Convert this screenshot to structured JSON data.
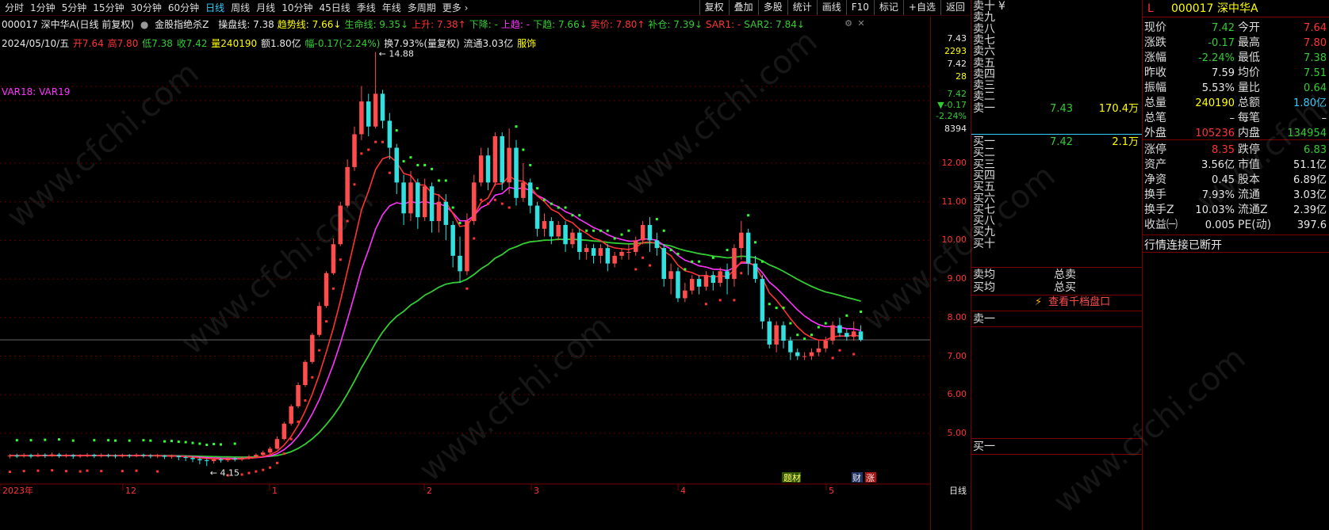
{
  "toolbar": {
    "periods": [
      "分时",
      "1分钟",
      "5分钟",
      "15分钟",
      "30分钟",
      "60分钟",
      "日线",
      "周线",
      "月线",
      "10分钟",
      "45日线",
      "季线",
      "年线",
      "多周期",
      "更多 ›"
    ],
    "active_period": "日线",
    "actions": [
      "复权",
      "叠加",
      "多股",
      "统计",
      "画线",
      "F10",
      "标记",
      "+自选",
      "返回"
    ]
  },
  "indicator_bar": {
    "stock": "000017 深中华A(日线 前复权)",
    "indicator_name": "金股指绝杀Z",
    "items": [
      {
        "text": "操盘线: 7.38",
        "color": "#e8e8e8"
      },
      {
        "text": "趋势线: 7.66↓",
        "color": "#ffff00"
      },
      {
        "text": "生命线: 9.35↓",
        "color": "#33cc33"
      },
      {
        "text": "上升: 7.38↑",
        "color": "#ff3333"
      },
      {
        "text": "下降: -",
        "color": "#33cc33"
      },
      {
        "text": "上趋: -",
        "color": "#ff33ff"
      },
      {
        "text": "下趋: 7.66↓",
        "color": "#33cc33"
      },
      {
        "text": "卖价: 7.80↑",
        "color": "#ff3333"
      },
      {
        "text": "补仓: 7.39↓",
        "color": "#33cc33"
      },
      {
        "text": "SAR1: -",
        "color": "#ff3333"
      },
      {
        "text": "SAR2: 7.84↓",
        "color": "#33cc33"
      }
    ]
  },
  "bar_info": {
    "date": "2024/05/10/五",
    "open": "开7.64",
    "high": "高7.80",
    "low": "低7.38",
    "close": "收7.42",
    "volume": "量240190",
    "amount": "额1.80亿",
    "change": "幅-0.17(-2.24%)",
    "turnover": "换7.93%(量复权)",
    "float": "流通3.03亿",
    "sector": "服饰"
  },
  "var_label": "VAR18: VAR19",
  "chart_annotations": {
    "high_label": "14.88",
    "low_label": "4.15",
    "marker_1": "题材",
    "marker_2": "财",
    "marker_3": "涨",
    "period_label": "日线"
  },
  "axis": {
    "right_top": [
      "7.43",
      "2293",
      "7.42",
      "28",
      "7.42",
      "▼-0.17",
      "-2.24%",
      "8394"
    ],
    "price_ticks": [
      "12.00",
      "11.00",
      "10.00",
      "9.00",
      "8.00",
      "7.00",
      "6.00",
      "5.00"
    ],
    "x_ticks": [
      "2023年",
      "12",
      "1",
      "2",
      "3",
      "4",
      "5"
    ]
  },
  "chart_data": {
    "type": "candlestick",
    "x_ticks": [
      "2023年",
      "12",
      "1",
      "2",
      "3",
      "4",
      "5"
    ],
    "ylim": [
      4.0,
      15.0
    ],
    "y_ticks": [
      5,
      6,
      7,
      8,
      9,
      10,
      11,
      12
    ],
    "current_price": 7.42,
    "high_annotation": 14.88,
    "low_annotation": 4.15,
    "series": [
      {
        "name": "操盘线",
        "color": "#e8e8e8"
      },
      {
        "name": "趋势线",
        "color": "#ffff00"
      },
      {
        "name": "生命线",
        "color": "#33cc33"
      },
      {
        "name": "上升",
        "color": "#ff3333"
      },
      {
        "name": "上趋",
        "color": "#ff33ff"
      },
      {
        "name": "SAR2",
        "color": "#33ff33"
      }
    ],
    "candles": [
      [
        4.4,
        4.42,
        4.35,
        4.46
      ],
      [
        4.42,
        4.41,
        4.36,
        4.47
      ],
      [
        4.41,
        4.43,
        4.37,
        4.48
      ],
      [
        4.43,
        4.4,
        4.35,
        4.47
      ],
      [
        4.4,
        4.44,
        4.38,
        4.49
      ],
      [
        4.44,
        4.42,
        4.36,
        4.48
      ],
      [
        4.42,
        4.45,
        4.39,
        4.5
      ],
      [
        4.45,
        4.41,
        4.36,
        4.49
      ],
      [
        4.41,
        4.43,
        4.37,
        4.47
      ],
      [
        4.43,
        4.4,
        4.34,
        4.46
      ],
      [
        4.4,
        4.42,
        4.36,
        4.46
      ],
      [
        4.42,
        4.44,
        4.38,
        4.49
      ],
      [
        4.44,
        4.41,
        4.36,
        4.47
      ],
      [
        4.41,
        4.43,
        4.37,
        4.48
      ],
      [
        4.43,
        4.42,
        4.37,
        4.47
      ],
      [
        4.42,
        4.4,
        4.35,
        4.46
      ],
      [
        4.4,
        4.43,
        4.37,
        4.47
      ],
      [
        4.43,
        4.41,
        4.36,
        4.46
      ],
      [
        4.41,
        4.44,
        4.38,
        4.48
      ],
      [
        4.44,
        4.42,
        4.37,
        4.47
      ],
      [
        4.42,
        4.4,
        4.35,
        4.46
      ],
      [
        4.4,
        4.42,
        4.36,
        4.46
      ],
      [
        4.42,
        4.39,
        4.33,
        4.44
      ],
      [
        4.39,
        4.41,
        4.34,
        4.45
      ],
      [
        4.41,
        4.38,
        4.3,
        4.43
      ],
      [
        4.38,
        4.36,
        4.28,
        4.42
      ],
      [
        4.36,
        4.33,
        4.25,
        4.4
      ],
      [
        4.33,
        4.3,
        4.2,
        4.38
      ],
      [
        4.3,
        4.28,
        4.15,
        4.35
      ],
      [
        4.28,
        4.32,
        4.22,
        4.37
      ],
      [
        4.32,
        4.3,
        4.24,
        4.36
      ],
      [
        4.3,
        4.34,
        4.26,
        4.38
      ],
      [
        4.34,
        4.32,
        4.27,
        4.38
      ],
      [
        4.32,
        4.36,
        4.28,
        4.4
      ],
      [
        4.36,
        4.4,
        4.32,
        4.44
      ],
      [
        4.4,
        4.44,
        4.36,
        4.48
      ],
      [
        4.44,
        4.5,
        4.4,
        4.55
      ],
      [
        4.5,
        4.6,
        4.46,
        4.65
      ],
      [
        4.6,
        4.85,
        4.58,
        4.92
      ],
      [
        4.85,
        5.25,
        4.82,
        5.3
      ],
      [
        5.25,
        5.7,
        5.2,
        5.75
      ],
      [
        5.7,
        6.25,
        5.65,
        6.32
      ],
      [
        6.25,
        6.85,
        6.2,
        6.9
      ],
      [
        6.85,
        7.55,
        6.8,
        7.6
      ],
      [
        7.55,
        8.3,
        7.5,
        8.4
      ],
      [
        8.3,
        9.15,
        8.25,
        9.2
      ],
      [
        9.15,
        9.9,
        9.1,
        10.05
      ],
      [
        9.9,
        10.9,
        9.85,
        11.0
      ],
      [
        10.9,
        11.9,
        10.85,
        12.1
      ],
      [
        11.9,
        12.75,
        11.8,
        12.95
      ],
      [
        12.75,
        13.6,
        12.6,
        14.0
      ],
      [
        13.6,
        12.95,
        12.7,
        13.8
      ],
      [
        12.95,
        13.8,
        12.9,
        14.88
      ],
      [
        13.8,
        13.1,
        12.9,
        13.9
      ],
      [
        13.1,
        12.4,
        12.1,
        13.3
      ],
      [
        12.4,
        11.5,
        11.2,
        12.5
      ],
      [
        11.5,
        10.7,
        10.4,
        11.7
      ],
      [
        10.7,
        11.5,
        10.5,
        11.8
      ],
      [
        11.5,
        10.6,
        10.3,
        11.6
      ],
      [
        10.6,
        11.4,
        10.5,
        11.6
      ],
      [
        11.4,
        10.5,
        10.2,
        11.5
      ],
      [
        10.5,
        11.0,
        10.2,
        11.2
      ],
      [
        11.0,
        10.4,
        10.0,
        11.2
      ],
      [
        10.4,
        9.6,
        9.3,
        10.5
      ],
      [
        9.6,
        9.2,
        8.9,
        10.1
      ],
      [
        9.2,
        10.5,
        9.1,
        10.7
      ],
      [
        10.5,
        11.5,
        10.4,
        11.7
      ],
      [
        11.5,
        12.2,
        11.4,
        12.4
      ],
      [
        12.2,
        11.5,
        11.3,
        12.4
      ],
      [
        11.5,
        12.7,
        11.4,
        12.8
      ],
      [
        12.7,
        11.5,
        11.3,
        12.8
      ],
      [
        11.5,
        12.4,
        11.2,
        12.9
      ],
      [
        12.4,
        11.1,
        10.9,
        12.6
      ],
      [
        11.1,
        11.5,
        11.0,
        12.0
      ],
      [
        11.5,
        10.9,
        10.7,
        11.6
      ],
      [
        10.9,
        10.3,
        10.1,
        11.0
      ],
      [
        10.3,
        10.5,
        10.1,
        10.7
      ],
      [
        10.5,
        10.1,
        9.9,
        10.6
      ],
      [
        10.1,
        10.4,
        10.0,
        10.5
      ],
      [
        10.4,
        9.9,
        9.7,
        10.5
      ],
      [
        9.9,
        10.2,
        9.8,
        10.3
      ],
      [
        10.2,
        9.7,
        9.5,
        10.3
      ],
      [
        9.7,
        9.8,
        9.5,
        9.9
      ],
      [
        9.8,
        9.6,
        9.4,
        9.9
      ],
      [
        9.6,
        9.8,
        9.4,
        9.9
      ],
      [
        9.8,
        9.4,
        9.2,
        9.9
      ],
      [
        9.4,
        9.6,
        9.3,
        9.7
      ],
      [
        9.6,
        9.7,
        9.5,
        9.8
      ],
      [
        9.7,
        9.7,
        9.5,
        9.9
      ],
      [
        9.7,
        10.0,
        9.6,
        10.1
      ],
      [
        10.0,
        10.4,
        9.9,
        10.5
      ],
      [
        10.4,
        10.0,
        9.7,
        10.6
      ],
      [
        10.0,
        9.8,
        9.6,
        10.2
      ],
      [
        9.8,
        9.0,
        8.8,
        9.9
      ],
      [
        9.0,
        9.2,
        8.6,
        9.4
      ],
      [
        9.2,
        8.5,
        8.4,
        9.3
      ],
      [
        8.5,
        8.7,
        8.4,
        8.9
      ],
      [
        8.7,
        9.0,
        8.6,
        9.1
      ],
      [
        9.0,
        8.8,
        8.6,
        9.1
      ],
      [
        8.8,
        9.1,
        8.7,
        9.2
      ],
      [
        9.1,
        8.9,
        8.7,
        9.2
      ],
      [
        8.9,
        9.2,
        8.8,
        9.3
      ],
      [
        9.2,
        9.0,
        8.6,
        9.4
      ],
      [
        9.0,
        9.8,
        8.8,
        9.9
      ],
      [
        9.8,
        10.2,
        9.5,
        10.5
      ],
      [
        10.2,
        9.4,
        9.1,
        10.3
      ],
      [
        9.4,
        9.0,
        8.9,
        9.6
      ],
      [
        9.0,
        7.9,
        7.7,
        9.1
      ],
      [
        7.9,
        7.3,
        7.2,
        8.0
      ],
      [
        7.3,
        7.8,
        7.1,
        7.9
      ],
      [
        7.8,
        7.4,
        7.2,
        7.9
      ],
      [
        7.4,
        7.1,
        6.9,
        7.5
      ],
      [
        7.1,
        7.0,
        6.9,
        7.2
      ],
      [
        7.0,
        7.0,
        6.9,
        7.1
      ],
      [
        7.0,
        7.1,
        6.9,
        7.2
      ],
      [
        7.1,
        7.2,
        7.0,
        7.4
      ],
      [
        7.2,
        7.4,
        7.1,
        7.5
      ],
      [
        7.4,
        7.8,
        7.3,
        7.9
      ],
      [
        7.8,
        7.6,
        7.5,
        8.0
      ],
      [
        7.6,
        7.5,
        7.4,
        7.7
      ],
      [
        7.5,
        7.64,
        7.4,
        7.9
      ],
      [
        7.64,
        7.42,
        7.38,
        7.8
      ]
    ]
  },
  "orderbook": {
    "sell_labels": [
      "卖十",
      "卖九",
      "卖八",
      "卖七",
      "卖六",
      "卖五",
      "卖四",
      "卖三",
      "卖二",
      "卖一"
    ],
    "sell_extra": "¥",
    "sell1_price": "7.43",
    "sell1_vol": "170.4万",
    "buy_labels": [
      "买一",
      "买二",
      "买三",
      "买四",
      "买五",
      "买六",
      "买七",
      "买八",
      "买九",
      "买十"
    ],
    "buy1_price": "7.42",
    "buy1_vol": "2.1万",
    "avg_sell": "卖均",
    "total_sell": "总卖",
    "avg_buy": "买均",
    "total_buy": "总买",
    "view_book_button": "查看千档盘口",
    "sell1_tick": "卖一",
    "buy1_tick": "买一"
  },
  "quote": {
    "flag": "L",
    "code": "000017",
    "name": "深中华A",
    "rows": [
      {
        "l1": "现价",
        "v1": "7.42",
        "c1": "#33cc33",
        "l2": "今开",
        "v2": "7.64",
        "c2": "#ff3333"
      },
      {
        "l1": "涨跌",
        "v1": "-0.17",
        "c1": "#33cc33",
        "l2": "最高",
        "v2": "7.80",
        "c2": "#ff3333"
      },
      {
        "l1": "涨幅",
        "v1": "-2.24%",
        "c1": "#33cc33",
        "l2": "最低",
        "v2": "7.38",
        "c2": "#33cc33"
      },
      {
        "l1": "昨收",
        "v1": "7.59",
        "c1": "#e8e8e8",
        "l2": "均价",
        "v2": "7.51",
        "c2": "#33cc33"
      },
      {
        "l1": "振幅",
        "v1": "5.53%",
        "c1": "#e8e8e8",
        "l2": "量比",
        "v2": "0.64",
        "c2": "#33cc33"
      },
      {
        "l1": "总量",
        "v1": "240190",
        "c1": "#ffff00",
        "l2": "总额",
        "v2": "1.80亿",
        "c2": "#33ccff"
      },
      {
        "l1": "总笔",
        "v1": "–",
        "c1": "#e8e8e8",
        "l2": "每笔",
        "v2": "–",
        "c2": "#e8e8e8"
      },
      {
        "l1": "外盘",
        "v1": "105236",
        "c1": "#ff3333",
        "l2": "内盘",
        "v2": "134954",
        "c2": "#33cc33"
      },
      {
        "l1": "涨停",
        "v1": "8.35",
        "c1": "#ff3333",
        "l2": "跌停",
        "v2": "6.83",
        "c2": "#33cc33"
      },
      {
        "l1": "资产",
        "v1": "3.56亿",
        "c1": "#e8e8e8",
        "l2": "市值",
        "v2": "51.1亿",
        "c2": "#e8e8e8"
      },
      {
        "l1": "净资",
        "v1": "0.45",
        "c1": "#e8e8e8",
        "l2": "股本",
        "v2": "6.89亿",
        "c2": "#e8e8e8"
      },
      {
        "l1": "换手",
        "v1": "7.93%",
        "c1": "#e8e8e8",
        "l2": "流通",
        "v2": "3.03亿",
        "c2": "#e8e8e8"
      },
      {
        "l1": "换手Z",
        "v1": "10.03%",
        "c1": "#e8e8e8",
        "l2": "流通Z",
        "v2": "2.39亿",
        "c2": "#e8e8e8"
      },
      {
        "l1": "收益㈠",
        "v1": "0.005",
        "c1": "#e8e8e8",
        "l2": "PE(动)",
        "v2": "397.6",
        "c2": "#e8e8e8"
      }
    ],
    "status": "行情连接已断开"
  },
  "watermark": "www.cfchi.com"
}
